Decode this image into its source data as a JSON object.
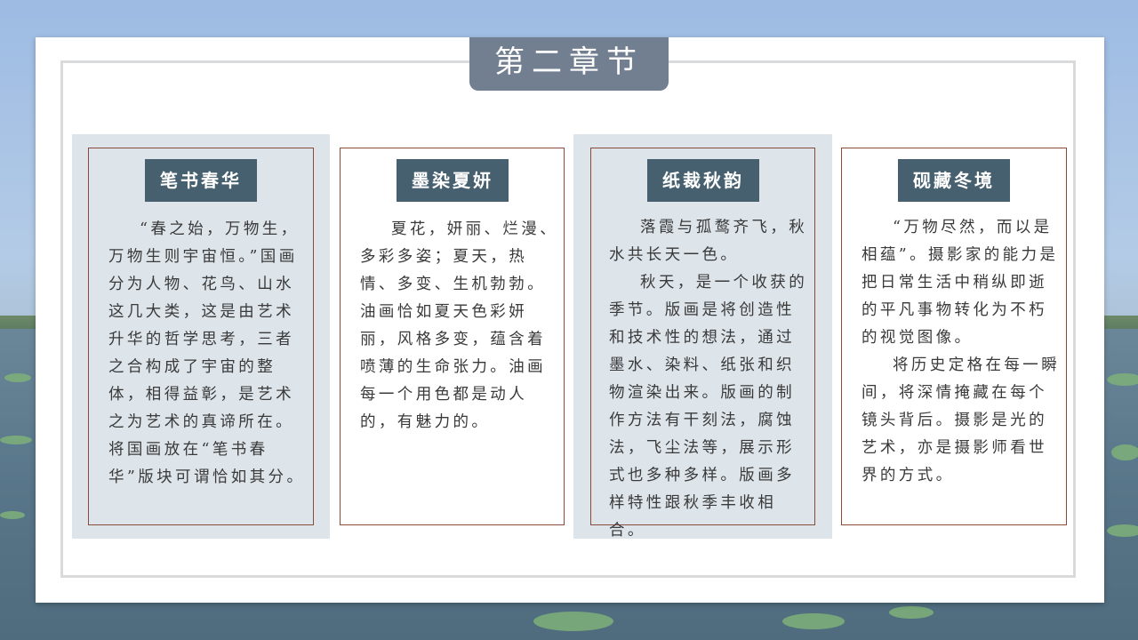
{
  "slide": {
    "title": "第二章节"
  },
  "cards": [
    {
      "title": "笔书春华",
      "paragraphs": [
        "“春之始，万物生，万物生则宇宙恒。”国画分为人物、花鸟、山水这几大类，这是由艺术升华的哲学思考，三者之合构成了宇宙的整体，相得益彰，是艺术之为艺术的真谛所在。将国画放在“笔书春华”版块可谓恰如其分。"
      ]
    },
    {
      "title": "墨染夏妍",
      "paragraphs": [
        "夏花，妍丽、烂漫、多彩多姿；夏天，热情、多变、生机勃勃。油画恰如夏天色彩妍丽，风格多变，蕴含着喷薄的生命张力。油画每一个用色都是动人的，有魅力的。"
      ]
    },
    {
      "title": "纸裁秋韵",
      "paragraphs": [
        "落霞与孤鹜齐飞，秋水共长天一色。",
        "秋天，是一个收获的季节。版画是将创造性和技术性的想法，通过墨水、染料、纸张和织物渲染出来。版画的制作方法有干刻法，腐蚀法，飞尘法等，展示形式也多种多样。版画多样特性跟秋季丰收相合。"
      ]
    },
    {
      "title": "砚藏冬境",
      "paragraphs": [
        "“万物尽然，而以是相蕴”。摄影家的能力是把日常生活中稍纵即逝的平凡事物转化为不朽的视觉图像。",
        "将历史定格在每一瞬间，将深情掩藏在每个镜头背后。摄影是光的艺术，亦是摄影师看世界的方式。"
      ]
    }
  ]
}
